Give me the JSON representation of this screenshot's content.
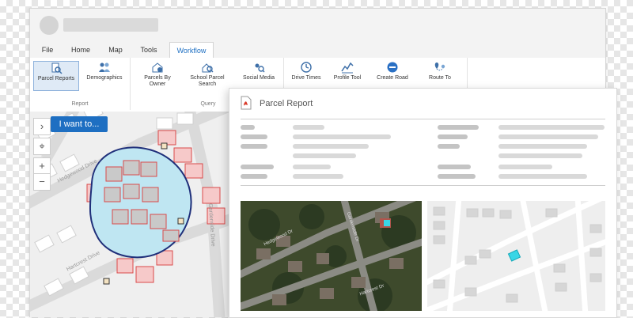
{
  "window": {
    "title_placeholder": ""
  },
  "tabs": [
    {
      "label": "File",
      "active": false
    },
    {
      "label": "Home",
      "active": false
    },
    {
      "label": "Map",
      "active": false
    },
    {
      "label": "Tools",
      "active": false
    },
    {
      "label": "Workflow",
      "active": true
    }
  ],
  "ribbon": {
    "report_group": {
      "label": "Report",
      "buttons": [
        {
          "label": "Parcel Reports",
          "icon": "parcel-report-icon",
          "selected": true
        },
        {
          "label": "Demographics",
          "icon": "demographics-icon",
          "selected": false
        }
      ]
    },
    "query_group": {
      "label": "Query",
      "buttons": [
        {
          "label": "Parcels By Owner",
          "icon": "parcels-by-owner-icon"
        },
        {
          "label": "School Parcel Search",
          "icon": "school-search-icon"
        },
        {
          "label": "Social Media",
          "icon": "social-media-icon"
        }
      ]
    },
    "tools_group": {
      "buttons": [
        {
          "label": "Drive Times",
          "icon": "drive-times-icon"
        },
        {
          "label": "Profile Tool",
          "icon": "profile-tool-icon"
        },
        {
          "label": "Create Road",
          "icon": "create-road-icon"
        },
        {
          "label": "Route To",
          "icon": "route-to-icon"
        }
      ]
    }
  },
  "map": {
    "i_want_to_label": "I want to...",
    "zoom_in": "+",
    "zoom_out": "−",
    "streets": [
      "Hedgewood Drive",
      "Hartcrest Drive",
      "Gardenside Drive"
    ],
    "colors": {
      "buffer": "#bfe6f2",
      "buffer_outline": "#1f2f7a",
      "selected_parcel": "#f6c9c9",
      "selected_outline": "#d94b4b"
    }
  },
  "report": {
    "title": "Parcel Report",
    "icon": "pdf-icon",
    "aerial_streets": [
      "Hedgewood Dr",
      "Gardenside Dr",
      "Hartcrest Dr"
    ],
    "highlight_color": "#39d6e6"
  }
}
